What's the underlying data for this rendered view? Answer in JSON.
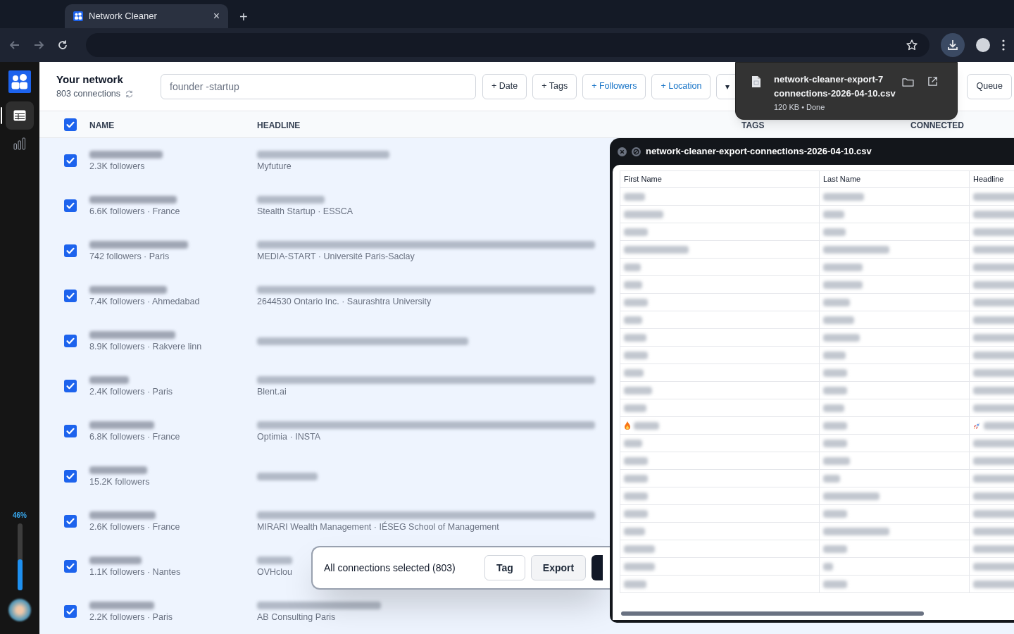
{
  "browser": {
    "tab_title": "Network Cleaner",
    "tab_close": "×",
    "new_tab": "+"
  },
  "sidebar": {
    "items": [
      {
        "kind": "table",
        "selected": true
      },
      {
        "kind": "chart",
        "selected": false
      }
    ],
    "usage": {
      "reading": "46%",
      "level": 0.46
    }
  },
  "header": {
    "title": "Your network",
    "subtitle": "803 connections",
    "search": {
      "value": "founder -startup"
    },
    "filters": [
      {
        "label": "+ Date",
        "highlighted": false
      },
      {
        "label": "+ Tags",
        "highlighted": false
      },
      {
        "label": "+ Followers",
        "highlighted": true
      },
      {
        "label": "+ Location",
        "highlighted": true
      }
    ],
    "more": "▾",
    "queue": "Queue"
  },
  "table": {
    "columns": [
      "NAME",
      "HEADLINE",
      "TAGS",
      "CONNECTED"
    ],
    "header_checked": true,
    "rows": [
      {
        "checked": true,
        "name_detail": "2.3K followers",
        "headline_detail": "Myfuture"
      },
      {
        "checked": true,
        "name_detail": "6.6K followers · France",
        "headline_detail": "Stealth Startup · ESSCA"
      },
      {
        "checked": true,
        "name_detail": "742 followers · Paris",
        "headline_detail": "MEDIA-START · Université Paris-Saclay"
      },
      {
        "checked": true,
        "name_detail": "7.4K followers · Ahmedabad",
        "headline_detail": "2644530 Ontario Inc. · Saurashtra University"
      },
      {
        "checked": true,
        "name_detail": "8.9K followers · Rakvere linn"
      },
      {
        "checked": true,
        "name_detail": "2.4K followers · Paris",
        "headline_detail": "Blent.ai"
      },
      {
        "checked": true,
        "name_detail": "6.8K followers · France",
        "headline_detail": "Optimia · INSTA"
      },
      {
        "checked": true,
        "name_detail": "15.2K followers"
      },
      {
        "checked": true,
        "name_detail": "2.6K followers · France",
        "headline_detail": "MIRARI Wealth Management · IÉSEG School of Management"
      },
      {
        "checked": true,
        "name_detail": "1.1K followers · Nantes",
        "headline_detail": "OVHclou"
      },
      {
        "checked": true,
        "name_detail": "2.2K followers · Paris",
        "headline_detail": "AB Consulting Paris"
      }
    ]
  },
  "download": {
    "filename_line1": "network-cleaner-export-7",
    "filename_line2": "connections-2026-04-10.csv",
    "status": "120 KB • Done"
  },
  "csv_viewer": {
    "title": "network-cleaner-export-connections-2026-04-10.csv",
    "columns": [
      "First Name",
      "Last Name",
      "Headline"
    ],
    "rows": [
      {
        "kind": "plain"
      },
      {
        "kind": "plain"
      },
      {
        "kind": "plain"
      },
      {
        "kind": "plain"
      },
      {
        "kind": "plain"
      },
      {
        "kind": "plain"
      },
      {
        "kind": "plain"
      },
      {
        "kind": "plain"
      },
      {
        "kind": "plain"
      },
      {
        "kind": "plain"
      },
      {
        "kind": "plain"
      },
      {
        "kind": "plain"
      },
      {
        "kind": "plain"
      },
      {
        "kind": "emoji"
      },
      {
        "kind": "plain"
      },
      {
        "kind": "plain"
      },
      {
        "kind": "plain"
      },
      {
        "kind": "plain"
      },
      {
        "kind": "plain"
      },
      {
        "kind": "plain"
      },
      {
        "kind": "plain"
      },
      {
        "kind": "plain"
      },
      {
        "kind": "plain"
      }
    ]
  },
  "selection_bar": {
    "text": "All connections selected (803)",
    "buttons": [
      "Tag",
      "Export"
    ]
  }
}
